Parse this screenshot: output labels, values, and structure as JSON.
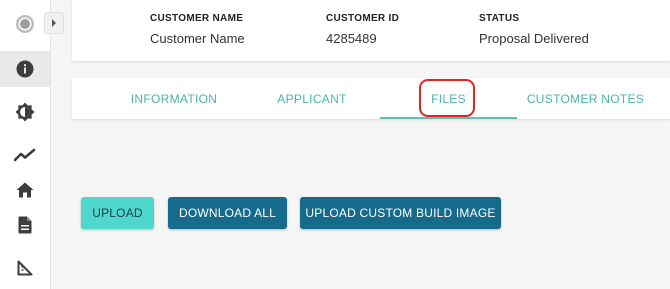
{
  "sidebar": {
    "items": [
      {
        "icon": "record-icon"
      },
      {
        "icon": "info-icon",
        "active": true
      },
      {
        "icon": "brightness-icon"
      },
      {
        "icon": "trending-icon"
      },
      {
        "icon": "home-icon"
      },
      {
        "icon": "document-icon"
      },
      {
        "icon": "ruler-square-icon"
      }
    ],
    "collapse_icon": "chevron-right-icon"
  },
  "header": {
    "customer_name_label": "CUSTOMER NAME",
    "customer_name_value": "Customer Name",
    "customer_id_label": "CUSTOMER ID",
    "customer_id_value": "4285489",
    "status_label": "STATUS",
    "status_value": "Proposal Delivered"
  },
  "tabs": [
    {
      "label": "INFORMATION"
    },
    {
      "label": "APPLICANT"
    },
    {
      "label": "FILES",
      "active": true
    },
    {
      "label": "CUSTOMER NOTES"
    }
  ],
  "actions": {
    "upload_label": "UPLOAD",
    "download_all_label": "DOWNLOAD ALL",
    "upload_custom_label": "UPLOAD CUSTOM BUILD IMAGE"
  },
  "colors": {
    "accent_teal": "#4bb5aa",
    "upload_button": "#4fd7ce",
    "primary_button": "#166a8c",
    "highlight_red": "#e0261d"
  }
}
